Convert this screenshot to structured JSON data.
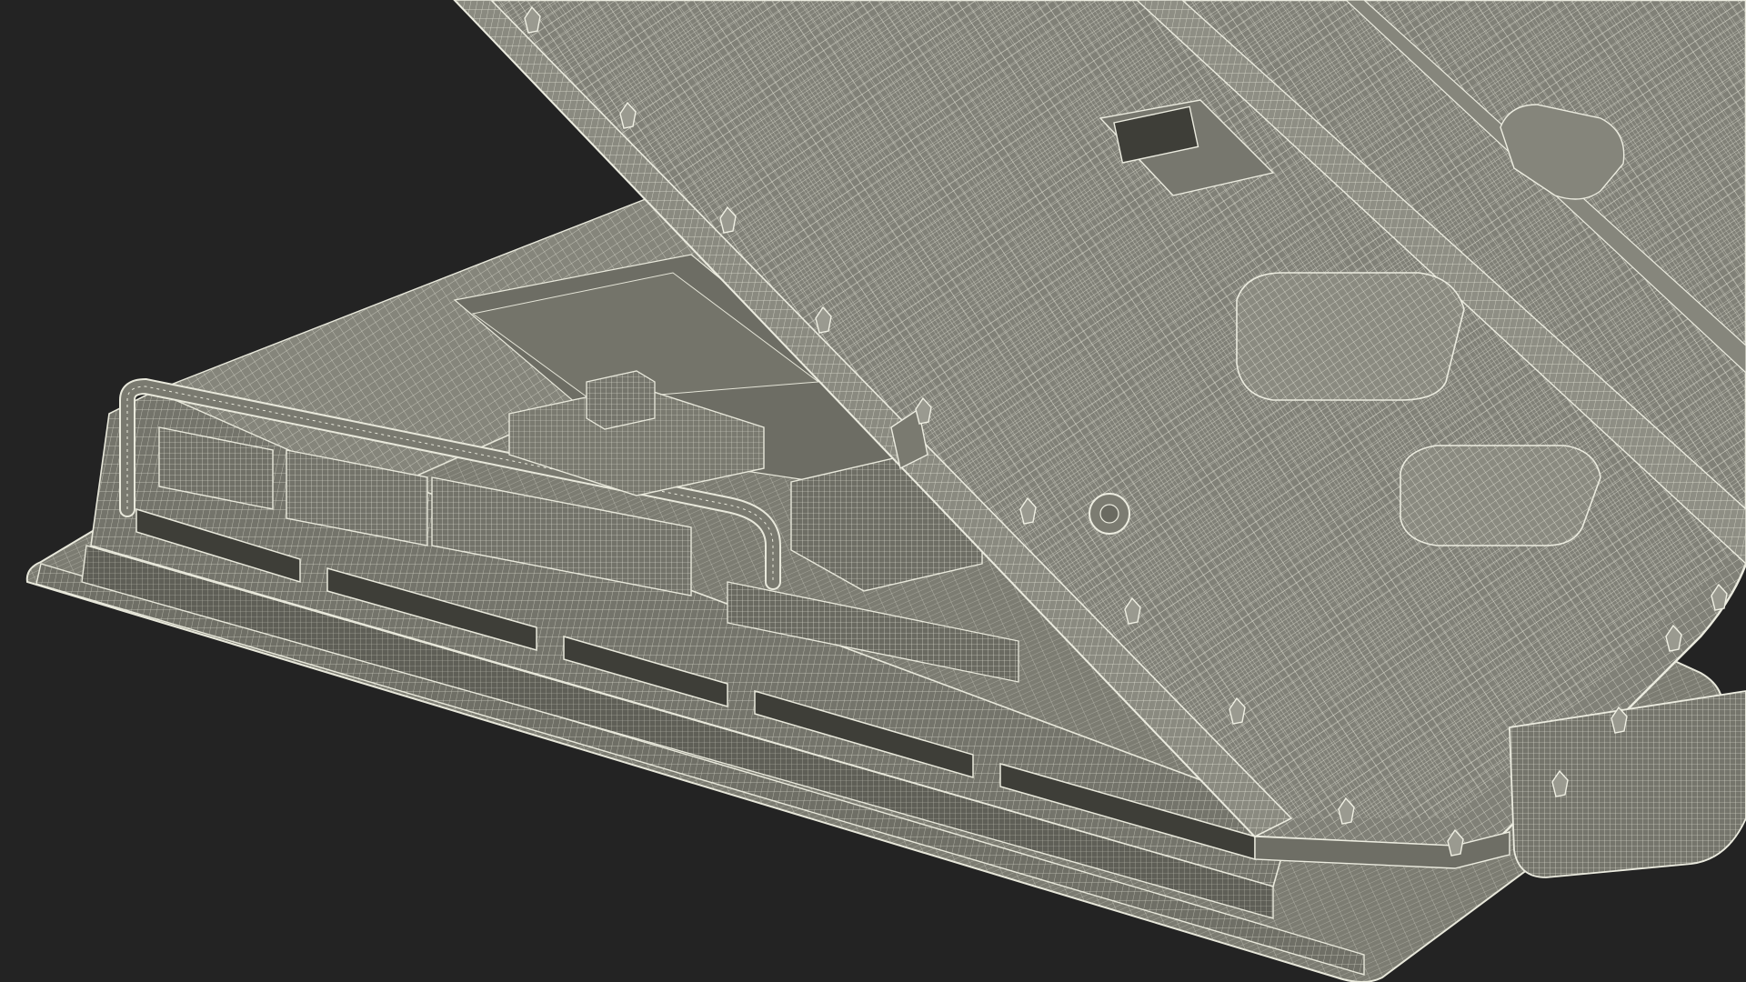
{
  "scene": {
    "background_color": "#232323",
    "surface_color": "#7e7e74",
    "surface_dark_color": "#66665e",
    "surface_light_color": "#8c8c82",
    "wire_color": "#e9e9dc",
    "wire_fine_color": "#cfcfc2"
  }
}
